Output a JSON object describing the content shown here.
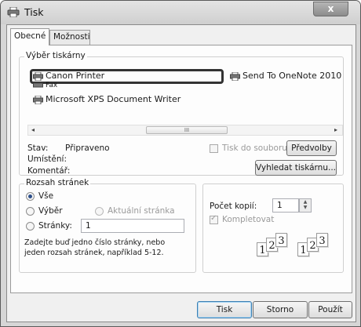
{
  "window": {
    "title": "Tisk",
    "close_label": "x"
  },
  "tabs": [
    {
      "label": "Obecné",
      "selected": true
    },
    {
      "label": "Možnosti",
      "selected": false
    }
  ],
  "printer_select": {
    "group_label": "Výběr tiskárny",
    "printers": [
      {
        "name": "Canon Printer",
        "selected": true
      },
      {
        "name": "Send To OneNote 2010",
        "selected": false
      },
      {
        "name": "Fax",
        "selected": false
      },
      {
        "name": "Microsoft XPS Document Writer",
        "selected": false
      }
    ],
    "scroll_thumb_glyph": "III",
    "status_label": "Stav:",
    "status_value": "Připraveno",
    "location_label": "Umístění:",
    "comment_label": "Komentář:",
    "print_to_file_label": "Tisk do souboru",
    "preferences_button": "Předvolby",
    "find_printer_button": "Vyhledat tiskárnu..."
  },
  "page_range": {
    "group_label": "Rozsah stránek",
    "all_label": "Vše",
    "selection_label": "Výběr",
    "current_page_label": "Aktuální stránka",
    "pages_label": "Stránky:",
    "pages_value": "1",
    "hint": [
      "Zadejte buď jedno číslo stránky, nebo",
      "jeden rozsah stránek, například 5-12."
    ]
  },
  "copies": {
    "copies_label": "Počet kopií:",
    "copies_value": "1",
    "collate_label": "Kompletovat",
    "collate_sets": [
      [
        "1",
        "2",
        "3"
      ],
      [
        "1",
        "2",
        "3"
      ]
    ]
  },
  "footer": {
    "print_button": "Tisk",
    "cancel_button": "Storno",
    "apply_button": "Použít"
  },
  "colors": {
    "highlight_border": "#333333",
    "default_button_border": "#3c7fb1",
    "radio_dot": "#2d4f8a"
  }
}
